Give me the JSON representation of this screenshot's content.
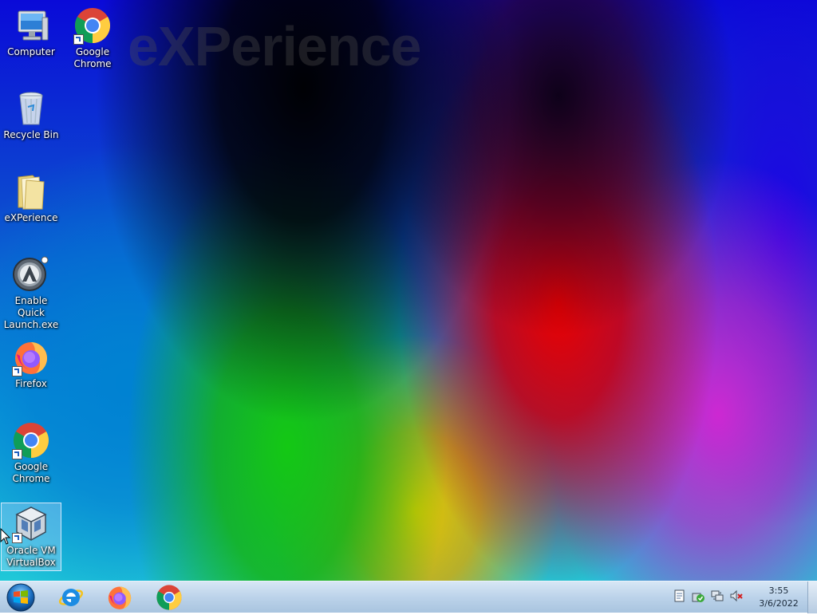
{
  "desktop": {
    "watermark": "eXPerience",
    "icons": [
      {
        "label": "Computer",
        "icon": "computer-icon"
      },
      {
        "label": "Google Chrome",
        "icon": "chrome-icon"
      },
      {
        "label": "Recycle Bin",
        "icon": "recycle-bin-icon"
      },
      {
        "label": "eXPerience",
        "icon": "folder-icon"
      },
      {
        "label": "Enable Quick Launch.exe",
        "icon": "app-launcher-icon"
      },
      {
        "label": "Firefox",
        "icon": "firefox-icon"
      },
      {
        "label": "Google Chrome",
        "icon": "chrome-icon"
      },
      {
        "label": "Oracle VM VirtualBox",
        "icon": "virtualbox-icon",
        "selected": true
      }
    ]
  },
  "taskbar": {
    "start_icon": "windows-start-icon",
    "pinned": [
      {
        "name": "Internet Explorer",
        "icon": "internet-explorer-icon"
      },
      {
        "name": "Firefox",
        "icon": "firefox-icon"
      },
      {
        "name": "Google Chrome",
        "icon": "chrome-icon"
      }
    ],
    "tray": [
      "document-icon",
      "security-check-icon",
      "network-icon",
      "volume-muted-icon"
    ],
    "clock": {
      "time": "3:55",
      "date": "3/6/2022"
    }
  },
  "colors": {
    "taskbar_top": "#d7e7f5",
    "taskbar_bottom": "#a9c4df",
    "selection": "#bedcff"
  }
}
